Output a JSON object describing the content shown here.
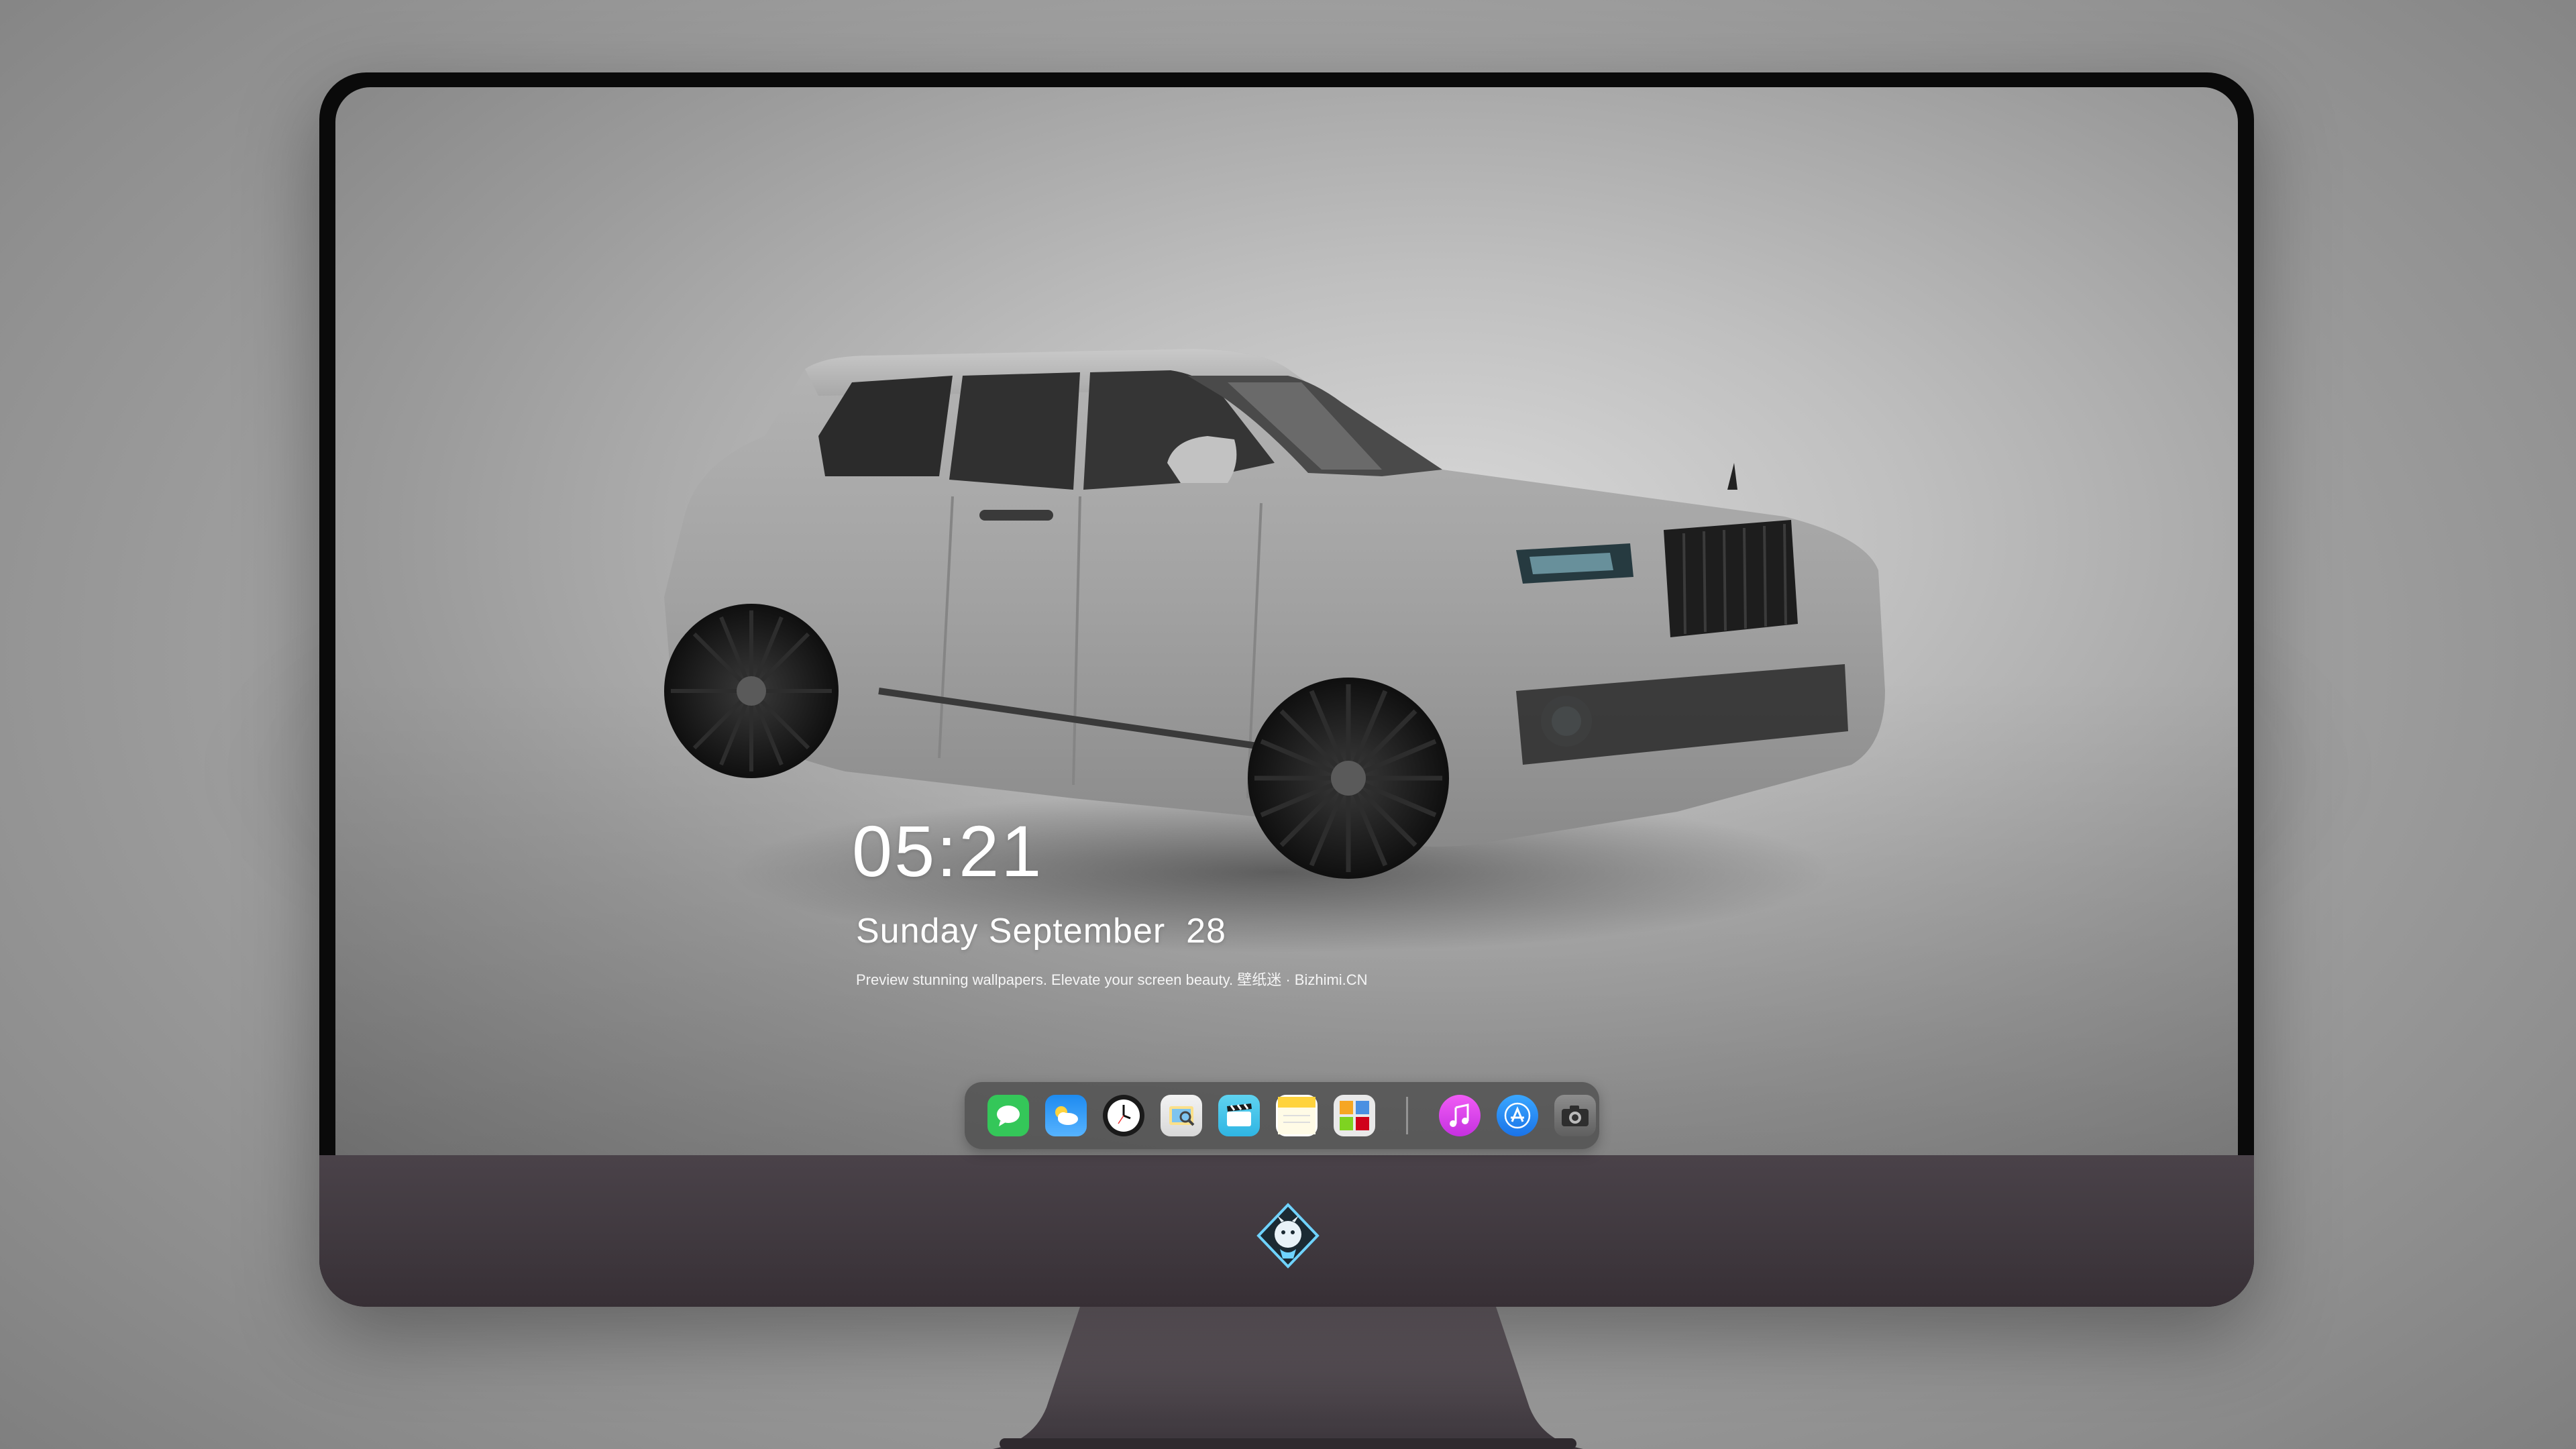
{
  "lockscreen": {
    "time": "05:21",
    "date": "Sunday September  28",
    "tagline": "Preview stunning wallpapers. Elevate your screen beauty. 壁纸迷 · Bizhimi.CN"
  },
  "dock": {
    "apps": [
      {
        "name": "Messages",
        "icon": "messages-icon"
      },
      {
        "name": "Weather",
        "icon": "weather-icon"
      },
      {
        "name": "Clock",
        "icon": "clock-icon"
      },
      {
        "name": "Preview",
        "icon": "preview-icon"
      },
      {
        "name": "Clips",
        "icon": "clips-icon"
      },
      {
        "name": "Notes",
        "icon": "notes-icon"
      },
      {
        "name": "Photo Booth",
        "icon": "photo-booth-icon"
      },
      {
        "name": "Music",
        "icon": "music-icon"
      },
      {
        "name": "App Store",
        "icon": "app-store-icon"
      },
      {
        "name": "Camera",
        "icon": "camera-icon"
      }
    ]
  },
  "colors": {
    "bezel": "#0a0a0a",
    "chin": "#3f383e",
    "dock_bg": "#484848",
    "messages": "#34c759",
    "weather": "#1e8bf0",
    "music": "#e13ff0",
    "app_store": "#1a8cff"
  }
}
